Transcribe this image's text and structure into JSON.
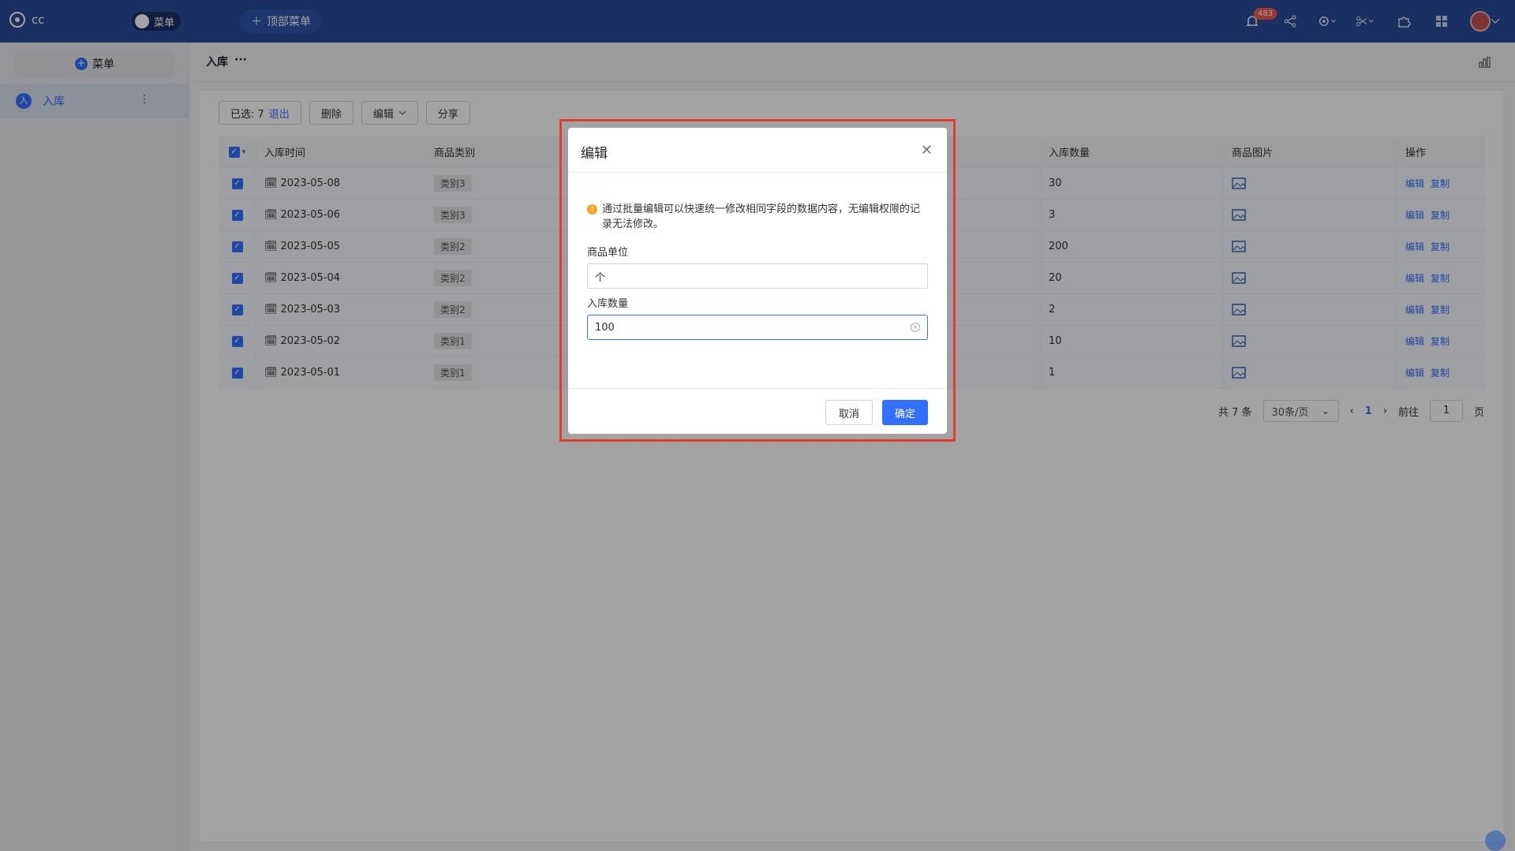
{
  "app": {
    "name": "cc",
    "menu_toggle": "菜单",
    "top_menu_button": "顶部菜单",
    "notification_count": "483"
  },
  "sidebar": {
    "add_label": "菜单",
    "items": [
      {
        "icon_text": "入",
        "label": "入库"
      }
    ]
  },
  "breadcrumb": {
    "title": "入库",
    "more": "···"
  },
  "toolbar": {
    "selected_prefix": "已选: 7",
    "exit_label": "退出",
    "delete_label": "删除",
    "edit_label": "编辑",
    "share_label": "分享"
  },
  "table": {
    "headers": {
      "time": "入库时间",
      "category": "商品类别",
      "qty": "入库数量",
      "image": "商品图片",
      "ops": "操作"
    },
    "rows": [
      {
        "date": "2023-05-08",
        "category": "类别3",
        "qty": "30"
      },
      {
        "date": "2023-05-06",
        "category": "类别3",
        "qty": "3"
      },
      {
        "date": "2023-05-05",
        "category": "类别2",
        "qty": "200"
      },
      {
        "date": "2023-05-04",
        "category": "类别2",
        "qty": "20"
      },
      {
        "date": "2023-05-03",
        "category": "类别2",
        "qty": "2"
      },
      {
        "date": "2023-05-02",
        "category": "类别1",
        "qty": "10"
      },
      {
        "date": "2023-05-01",
        "category": "类别1",
        "qty": "1"
      }
    ],
    "op_edit": "编辑",
    "op_copy": "复制"
  },
  "pagination": {
    "total": "共 7 条",
    "page_size": "30条/页",
    "current": "1",
    "goto_prefix": "前往",
    "goto_value": "1",
    "goto_suffix": "页"
  },
  "modal": {
    "title": "编辑",
    "notice": "通过批量编辑可以快速统一修改相同字段的数据内容，无编辑权限的记录无法修改。",
    "field1_label": "商品单位",
    "field1_value": "个",
    "field2_label": "入库数量",
    "field2_value": "100",
    "cancel": "取消",
    "confirm": "确定"
  },
  "colors": {
    "topbar": "#2a4b9b",
    "accent": "#3370ff",
    "highlight_box": "#e53935"
  }
}
